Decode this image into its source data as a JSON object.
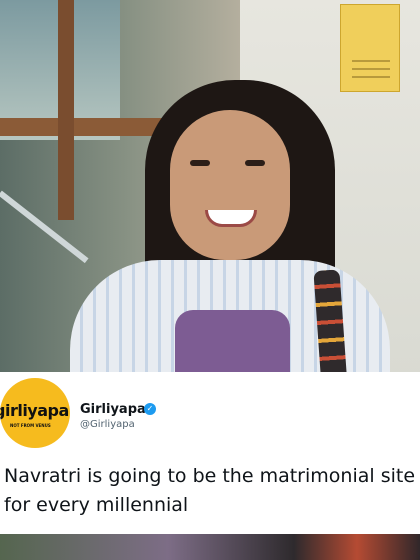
{
  "tweet": {
    "account_name": "Girliyapa",
    "handle": "@Girliyapa",
    "text": "Navratri is going to be the matrimonial site for every millennial",
    "verified_color": "#1d9bf0"
  },
  "logo": {
    "wordmark": "girliyapa",
    "tagline": "NOT FROM VENUS",
    "color": "#f6bb1e"
  }
}
